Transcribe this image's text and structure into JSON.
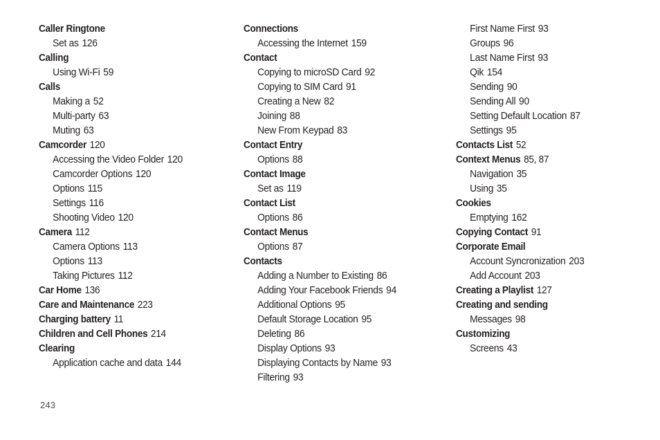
{
  "page": {
    "type": "book-index",
    "page_number": "243",
    "background_color": "#ffffff",
    "text_color": "#231f20",
    "column_count": 3
  },
  "columns": [
    {
      "name": "column-1",
      "entries": [
        {
          "level": "head",
          "label": "Caller Ringtone",
          "pages": ""
        },
        {
          "level": "sub",
          "label": "Set as",
          "pages": "126"
        },
        {
          "level": "head",
          "label": "Calling",
          "pages": ""
        },
        {
          "level": "sub",
          "label": "Using Wi-Fi",
          "pages": "59"
        },
        {
          "level": "head",
          "label": "Calls",
          "pages": ""
        },
        {
          "level": "sub",
          "label": "Making a",
          "pages": "52"
        },
        {
          "level": "sub",
          "label": "Multi-party",
          "pages": "63"
        },
        {
          "level": "sub",
          "label": "Muting",
          "pages": "63"
        },
        {
          "level": "head",
          "label": "Camcorder",
          "pages": "120"
        },
        {
          "level": "sub",
          "label": "Accessing the Video Folder",
          "pages": "120"
        },
        {
          "level": "sub",
          "label": "Camcorder Options",
          "pages": "120"
        },
        {
          "level": "sub",
          "label": "Options",
          "pages": "115"
        },
        {
          "level": "sub",
          "label": "Settings",
          "pages": "116"
        },
        {
          "level": "sub",
          "label": "Shooting Video",
          "pages": "120"
        },
        {
          "level": "head",
          "label": "Camera",
          "pages": "112"
        },
        {
          "level": "sub",
          "label": "Camera Options",
          "pages": "113"
        },
        {
          "level": "sub",
          "label": "Options",
          "pages": "113"
        },
        {
          "level": "sub",
          "label": "Taking Pictures",
          "pages": "112"
        },
        {
          "level": "head",
          "label": "Car Home",
          "pages": "136"
        },
        {
          "level": "head",
          "label": "Care and Maintenance",
          "pages": "223"
        },
        {
          "level": "head",
          "label": "Charging battery",
          "pages": "11"
        },
        {
          "level": "head",
          "label": "Children and Cell Phones",
          "pages": "214"
        },
        {
          "level": "head",
          "label": "Clearing",
          "pages": ""
        },
        {
          "level": "sub",
          "label": "Application cache and data",
          "pages": "144"
        }
      ]
    },
    {
      "name": "column-2",
      "entries": [
        {
          "level": "head",
          "label": "Connections",
          "pages": ""
        },
        {
          "level": "sub",
          "label": "Accessing the Internet",
          "pages": "159"
        },
        {
          "level": "head",
          "label": "Contact",
          "pages": ""
        },
        {
          "level": "sub",
          "label": "Copying to microSD Card",
          "pages": "92"
        },
        {
          "level": "sub",
          "label": "Copying to SIM Card",
          "pages": "91"
        },
        {
          "level": "sub",
          "label": "Creating a New",
          "pages": "82"
        },
        {
          "level": "sub",
          "label": "Joining",
          "pages": "88"
        },
        {
          "level": "sub",
          "label": "New From Keypad",
          "pages": "83"
        },
        {
          "level": "head",
          "label": "Contact Entry",
          "pages": ""
        },
        {
          "level": "sub",
          "label": "Options",
          "pages": "88"
        },
        {
          "level": "head",
          "label": "Contact Image",
          "pages": ""
        },
        {
          "level": "sub",
          "label": "Set as",
          "pages": "119"
        },
        {
          "level": "head",
          "label": "Contact List",
          "pages": ""
        },
        {
          "level": "sub",
          "label": "Options",
          "pages": "86"
        },
        {
          "level": "head",
          "label": "Contact Menus",
          "pages": ""
        },
        {
          "level": "sub",
          "label": "Options",
          "pages": "87"
        },
        {
          "level": "head",
          "label": "Contacts",
          "pages": ""
        },
        {
          "level": "sub",
          "label": "Adding a Number to Existing",
          "pages": "86"
        },
        {
          "level": "sub",
          "label": "Adding Your Facebook Friends",
          "pages": "94"
        },
        {
          "level": "sub",
          "label": "Additional Options",
          "pages": "95"
        },
        {
          "level": "sub",
          "label": "Default Storage Location",
          "pages": "95"
        },
        {
          "level": "sub",
          "label": "Deleting",
          "pages": "86"
        },
        {
          "level": "sub",
          "label": "Display Options",
          "pages": "93"
        },
        {
          "level": "sub",
          "label": "Displaying Contacts by Name",
          "pages": "93"
        },
        {
          "level": "sub",
          "label": "Filtering",
          "pages": "93"
        }
      ]
    },
    {
      "name": "column-3",
      "entries": [
        {
          "level": "sub",
          "label": "First Name First",
          "pages": "93"
        },
        {
          "level": "sub",
          "label": "Groups",
          "pages": "96"
        },
        {
          "level": "sub",
          "label": "Last Name First",
          "pages": "93"
        },
        {
          "level": "sub",
          "label": "Qik",
          "pages": "154"
        },
        {
          "level": "sub",
          "label": "Sending",
          "pages": "90"
        },
        {
          "level": "sub",
          "label": "Sending All",
          "pages": "90"
        },
        {
          "level": "sub",
          "label": "Setting Default Location",
          "pages": "87"
        },
        {
          "level": "sub",
          "label": "Settings",
          "pages": "95"
        },
        {
          "level": "head",
          "label": "Contacts List",
          "pages": "52"
        },
        {
          "level": "head",
          "label": "Context Menus",
          "pages": "85, 87"
        },
        {
          "level": "sub",
          "label": "Navigation",
          "pages": "35"
        },
        {
          "level": "sub",
          "label": "Using",
          "pages": "35"
        },
        {
          "level": "head",
          "label": "Cookies",
          "pages": ""
        },
        {
          "level": "sub",
          "label": "Emptying",
          "pages": "162"
        },
        {
          "level": "head",
          "label": "Copying Contact",
          "pages": "91"
        },
        {
          "level": "head",
          "label": "Corporate Email",
          "pages": ""
        },
        {
          "level": "sub",
          "label": "Account Syncronization",
          "pages": "203"
        },
        {
          "level": "sub",
          "label": "Add Account",
          "pages": "203"
        },
        {
          "level": "head",
          "label": "Creating a Playlist",
          "pages": "127"
        },
        {
          "level": "head",
          "label": "Creating and sending",
          "pages": ""
        },
        {
          "level": "sub",
          "label": "Messages",
          "pages": "98"
        },
        {
          "level": "head",
          "label": "Customizing",
          "pages": ""
        },
        {
          "level": "sub",
          "label": "Screens",
          "pages": "43"
        }
      ]
    }
  ]
}
